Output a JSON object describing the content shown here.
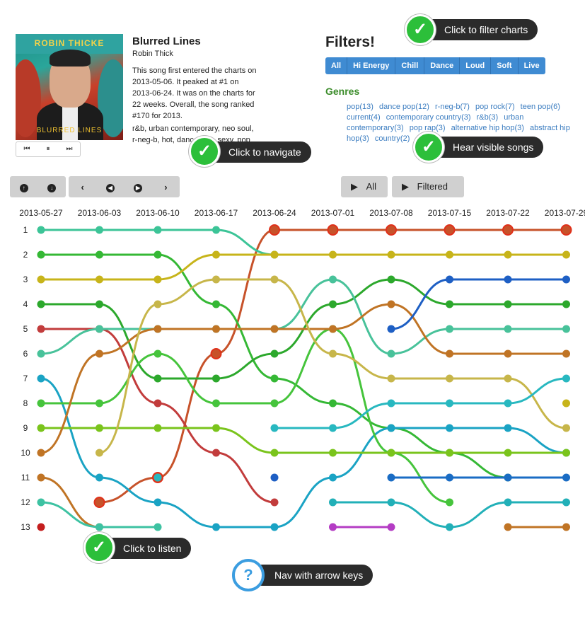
{
  "song": {
    "album_artist_text": "ROBIN THICKE",
    "album_title_text": "BLURRED LINES",
    "title": "Blurred Lines",
    "artist": "Robin Thick",
    "description": "This song first entered the charts on 2013-05-06. It peaked at #1 on 2013-06-24. It was on the charts for 22 weeks. Overall, the song ranked #170 for 2013.",
    "tags": "r&b, urban contemporary, neo soul, r-neg-b, hot, dance pop, sexy, pop"
  },
  "player": {
    "prev_icon": "skip-back-icon",
    "pause_icon": "pause-icon",
    "next_icon": "skip-forward-icon",
    "prev": "⏮",
    "pause": "⏸",
    "next": "⏭"
  },
  "filters": {
    "title": "Filters!",
    "buttons": [
      "All",
      "Hi Energy",
      "Chill",
      "Dance",
      "Loud",
      "Soft",
      "Live"
    ],
    "genres_title": "Genres",
    "genres": [
      "pop(13)",
      "dance pop(12)",
      "r-neg-b(7)",
      "pop rock(7)",
      "teen pop(6)",
      "current(4)",
      "contemporary country(3)",
      "r&b(3)",
      "urban contemporary(3)",
      "pop rap(3)",
      "alternative hip hop(3)",
      "abstract hip hop(3)",
      "country(2)"
    ]
  },
  "nav": {
    "up": "↑",
    "down": "↓",
    "first": "‹",
    "prev": "◀",
    "next": "▶",
    "last": "›",
    "play_all": "All",
    "play_filtered": "Filtered",
    "play_symbol": "▶"
  },
  "callouts": {
    "filter": "Click to filter charts",
    "navigate": "Click to navigate",
    "hear": "Hear visible songs",
    "listen": "Click to listen",
    "keys": "Nav with arrow keys",
    "check": "✓",
    "question": "?"
  },
  "colors": {
    "accent_blue": "#3f8bd2",
    "genre_green": "#3b8c2a",
    "callout_green": "#2cbf3a",
    "callout_blue": "#3b9de0"
  },
  "chart_data": {
    "type": "line",
    "x": [
      "2013-05-27",
      "2013-06-03",
      "2013-06-10",
      "2013-06-17",
      "2013-06-24",
      "2013-07-01",
      "2013-07-08",
      "2013-07-15",
      "2013-07-22",
      "2013-07-29"
    ],
    "y_ranks": [
      1,
      2,
      3,
      4,
      5,
      6,
      7,
      8,
      9,
      10,
      11,
      12,
      13
    ],
    "ylim": [
      1,
      13
    ],
    "series": [
      {
        "color": "#c7522a",
        "ranks": [
          null,
          12,
          11,
          6,
          1,
          1,
          1,
          1,
          1,
          1
        ],
        "highlight": true
      },
      {
        "color": "#3cc497",
        "ranks": [
          1,
          1,
          1,
          1,
          2,
          null,
          null,
          null,
          null,
          null
        ]
      },
      {
        "color": "#35b835",
        "ranks": [
          2,
          2,
          2,
          4,
          7,
          8,
          9,
          10,
          11,
          null
        ]
      },
      {
        "color": "#c7b41a",
        "ranks": [
          3,
          3,
          3,
          2,
          2,
          2,
          2,
          2,
          2,
          2
        ]
      },
      {
        "color": "#2ca82c",
        "ranks": [
          4,
          4,
          7,
          7,
          6,
          4,
          3,
          4,
          4,
          4
        ]
      },
      {
        "color": "#c23c3c",
        "ranks": [
          5,
          5,
          8,
          10,
          12,
          null,
          null,
          null,
          null,
          null
        ]
      },
      {
        "color": "#48c29a",
        "ranks": [
          6,
          5,
          5,
          5,
          5,
          3,
          6,
          5,
          5,
          5
        ]
      },
      {
        "color": "#1aa3c4",
        "ranks": [
          7,
          11,
          12,
          13,
          13,
          11,
          9,
          9,
          9,
          10
        ]
      },
      {
        "color": "#46c43c",
        "ranks": [
          8,
          8,
          6,
          8,
          8,
          5,
          10,
          12,
          null,
          null
        ]
      },
      {
        "color": "#7ac41c",
        "ranks": [
          9,
          9,
          9,
          9,
          10,
          10,
          10,
          10,
          10,
          10
        ]
      },
      {
        "color": "#c07425",
        "ranks": [
          10,
          6,
          5,
          5,
          5,
          5,
          4,
          6,
          6,
          6
        ]
      },
      {
        "color": "#c07425",
        "ranks": [
          11,
          13,
          null,
          null,
          null,
          null,
          null,
          null,
          13,
          13
        ]
      },
      {
        "color": "#3dc2a2",
        "ranks": [
          12,
          13,
          13,
          null,
          null,
          null,
          null,
          null,
          null,
          null
        ]
      },
      {
        "color": "#c41e1e",
        "ranks": [
          13,
          null,
          null,
          null,
          null,
          null,
          null,
          null,
          null,
          null
        ]
      },
      {
        "color": "#c7b64a",
        "ranks": [
          null,
          10,
          4,
          3,
          3,
          6,
          7,
          7,
          7,
          9
        ]
      },
      {
        "color": "#1e5fc4",
        "ranks": [
          null,
          null,
          null,
          null,
          11,
          null,
          5,
          3,
          3,
          3
        ]
      },
      {
        "color": "#28b8c0",
        "ranks": [
          null,
          null,
          11,
          null,
          9,
          9,
          8,
          8,
          8,
          7
        ]
      },
      {
        "color": "#b43cc4",
        "ranks": [
          null,
          null,
          null,
          null,
          null,
          13,
          13,
          null,
          null,
          null
        ]
      },
      {
        "color": "#22b0b8",
        "ranks": [
          null,
          null,
          null,
          null,
          null,
          12,
          12,
          13,
          12,
          12
        ]
      },
      {
        "color": "#1a6cc4",
        "ranks": [
          null,
          null,
          null,
          null,
          null,
          null,
          11,
          11,
          11,
          11
        ]
      },
      {
        "color": "#c7b41a",
        "ranks": [
          null,
          null,
          null,
          null,
          null,
          null,
          null,
          null,
          null,
          8
        ]
      }
    ]
  }
}
